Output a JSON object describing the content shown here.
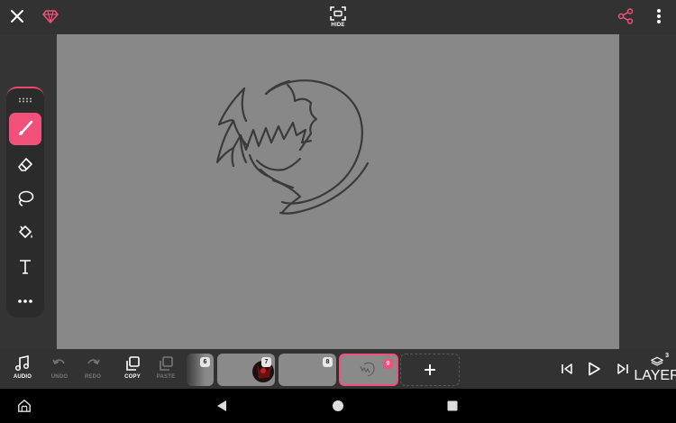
{
  "colors": {
    "accent": "#f0507a",
    "canvas_bg": "#888888",
    "panel_bg": "#323232"
  },
  "header": {
    "close_icon": "close-icon",
    "premium_icon": "diamond-icon",
    "hide_label": "HIDE",
    "share_icon": "share-icon",
    "more_icon": "more-vertical-icon"
  },
  "toolbar": {
    "tools": [
      {
        "name": "brush",
        "icon": "brush-icon",
        "active": true
      },
      {
        "name": "eraser",
        "icon": "eraser-icon",
        "active": false
      },
      {
        "name": "lasso",
        "icon": "lasso-icon",
        "active": false
      },
      {
        "name": "fill",
        "icon": "fill-bucket-icon",
        "active": false
      },
      {
        "name": "text",
        "icon": "text-icon",
        "active": false
      },
      {
        "name": "more",
        "icon": "more-horizontal-icon",
        "active": false
      }
    ]
  },
  "timeline": {
    "audio_label": "AUDIO",
    "undo_label": "UNDO",
    "redo_label": "REDO",
    "copy_label": "COPY",
    "paste_label": "PASTE",
    "frames": [
      "6",
      "7",
      "8",
      "9"
    ],
    "selected_frame": "9",
    "layer_label": "LAYER",
    "layer_count": "3"
  }
}
